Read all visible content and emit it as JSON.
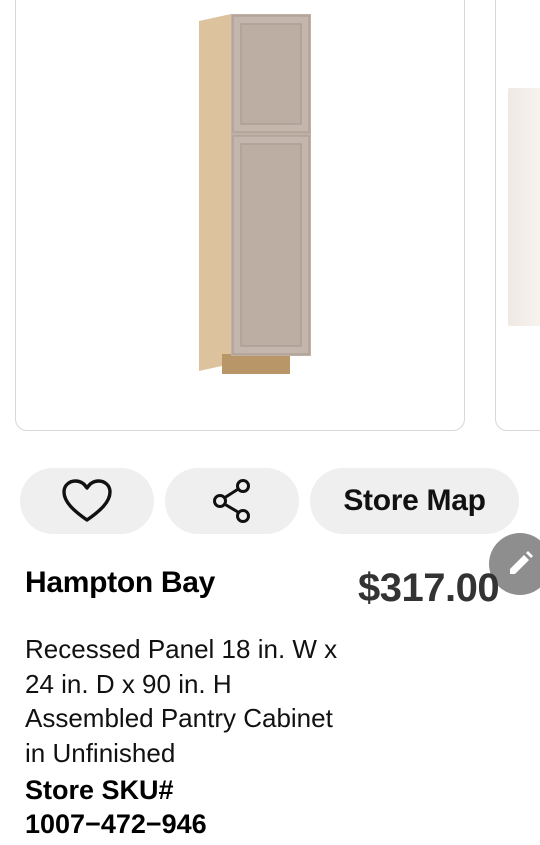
{
  "product": {
    "image_alt": "Tall unfinished pantry cabinet",
    "brand": "Hampton Bay",
    "price": "$317.00",
    "description": "Recessed Panel 18 in. W x 24 in. D x 90 in. H Assembled Pantry Cabinet in Unfinished",
    "sku_label": "Store SKU#",
    "sku_value": "1007−472−946"
  },
  "actions": {
    "favorite_icon": "heart-outline-icon",
    "share_icon": "share-icon",
    "store_map_label": "Store Map",
    "edit_icon": "pencil-icon"
  },
  "colors": {
    "button_bg": "#efefef",
    "card_border": "#d8d8d8",
    "fab_bg": "#8e8e8e",
    "price_text": "#333333"
  }
}
